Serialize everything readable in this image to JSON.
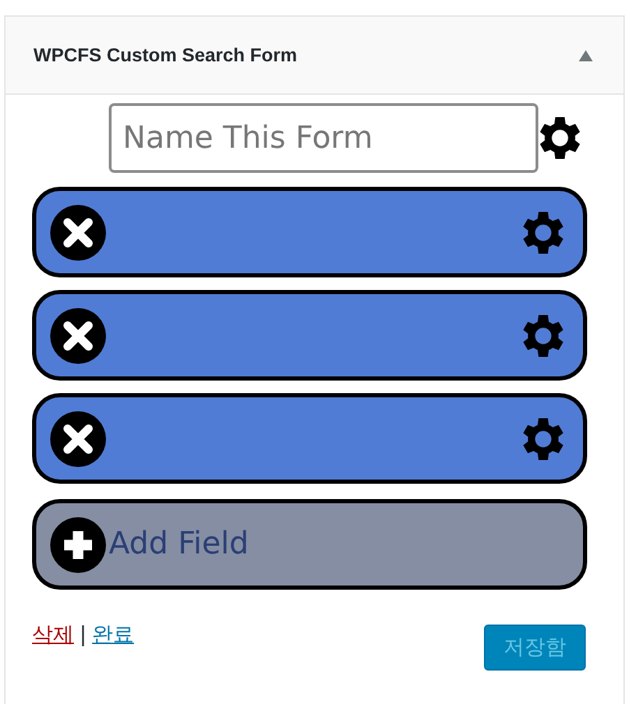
{
  "panel": {
    "title": "WPCFS Custom Search Form",
    "expanded": true
  },
  "form_name": {
    "placeholder": "Name This Form"
  },
  "fields": [
    {
      "kind": "field"
    },
    {
      "kind": "field"
    },
    {
      "kind": "field"
    }
  ],
  "add_field": {
    "label": "Add Field"
  },
  "footer": {
    "delete_link": "삭제",
    "separator": "|",
    "done_link": "완료",
    "save_button": {
      "label": "저장함",
      "disabled": true
    }
  }
}
